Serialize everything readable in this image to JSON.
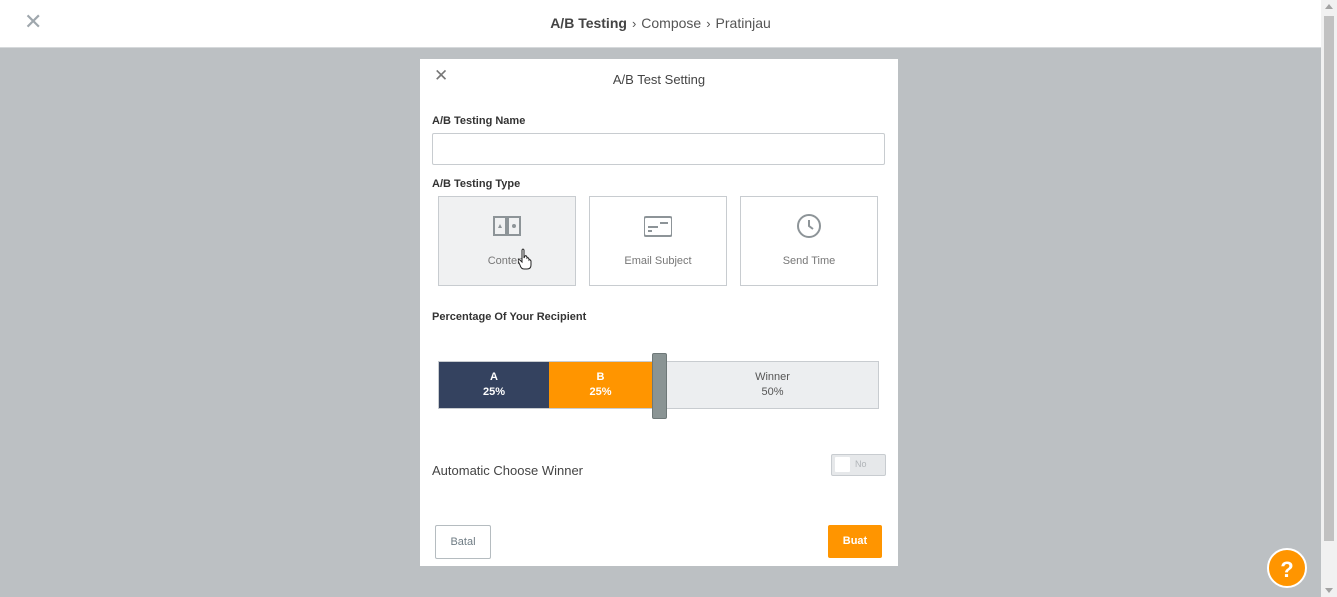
{
  "header": {
    "close_icon": "close-icon",
    "breadcrumb": [
      "A/B Testing",
      "Compose",
      "Pratinjau"
    ]
  },
  "modal": {
    "title": "A/B Test Setting",
    "close_icon": "close-icon",
    "name_label": "A/B Testing Name",
    "name_value": "",
    "type_label": "A/B Testing Type",
    "types": [
      {
        "label": "Content",
        "icon": "content-split-icon",
        "selected": true
      },
      {
        "label": "Email Subject",
        "icon": "email-subject-icon",
        "selected": false
      },
      {
        "label": "Send Time",
        "icon": "clock-icon",
        "selected": false
      }
    ],
    "percentage_label": "Percentage Of Your Recipient",
    "split": {
      "a": {
        "name": "A",
        "percent": "25%"
      },
      "b": {
        "name": "B",
        "percent": "25%"
      },
      "winner": {
        "name": "Winner",
        "percent": "50%"
      }
    },
    "auto_winner_label": "Automatic Choose Winner",
    "auto_winner_toggle": "No",
    "cancel_label": "Batal",
    "create_label": "Buat"
  },
  "help_label": "?",
  "colors": {
    "accent": "#ff9500",
    "navy": "#34425f",
    "overlay": "#bcc0c3"
  }
}
